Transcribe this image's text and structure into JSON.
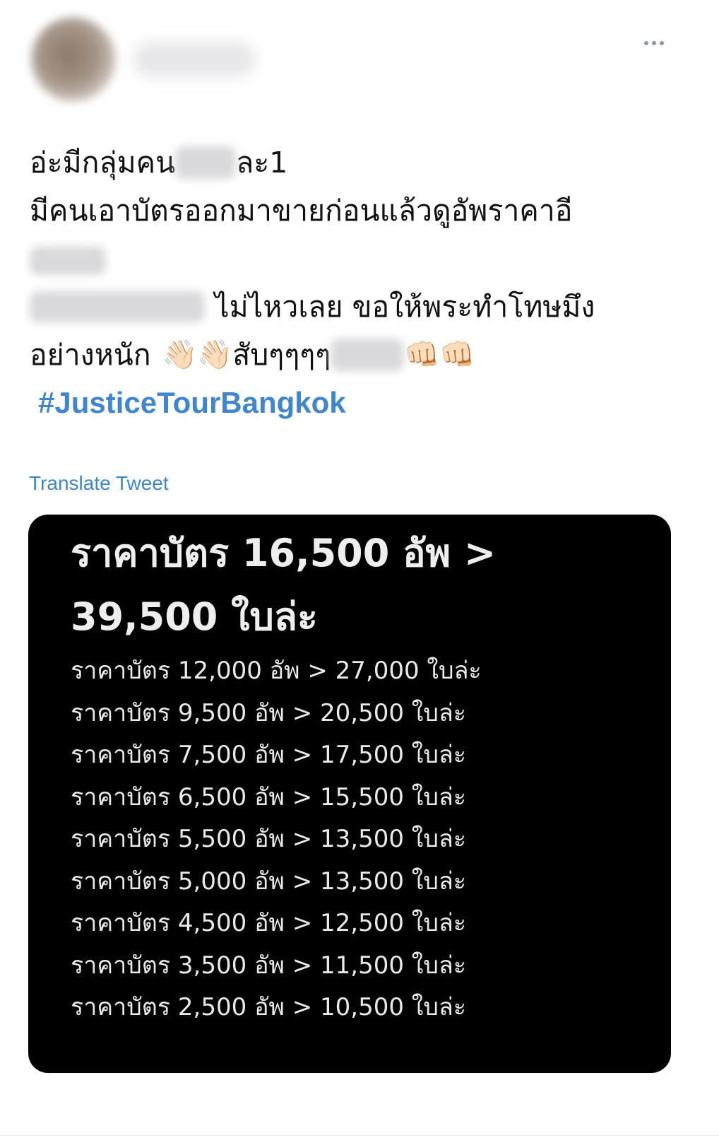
{
  "tweet": {
    "text_lines": [
      [
        "อ่ะมีกลุ่มคน",
        "",
        "ละ1"
      ],
      [
        "มีคนเอาบัตรออกมาขายก่อนแล้วดูอัพราคาอี"
      ],
      [
        "ไม่ไหวเลย ขอให้พระทำโทษมึง"
      ],
      [
        "อย่างหนัก",
        "👋🏻👋🏻",
        "สับๆๆๆๆ",
        "👊🏻👊🏻"
      ]
    ],
    "hashtag": "#JusticeTourBangkok",
    "translate_label": "Translate Tweet"
  },
  "media": {
    "headline": [
      "ราคาบัตร 16,500 อัพ >",
      "39,500 ใบล่ะ"
    ],
    "rows": [
      "ราคาบัตร 12,000 อัพ > 27,000 ใบล่ะ",
      "ราคาบัตร 9,500 อัพ > 20,500 ใบล่ะ",
      "ราคาบัตร 7,500 อัพ > 17,500 ใบล่ะ",
      "ราคาบัตร 6,500 อัพ > 15,500 ใบล่ะ",
      "ราคาบัตร 5,500 อัพ > 13,500 ใบล่ะ",
      "ราคาบัตร 5,000 อัพ > 13,500 ใบล่ะ",
      "ราคาบัตร 4,500 อัพ > 12,500 ใบล่ะ",
      "ราคาบัตร 3,500 อัพ > 11,500 ใบล่ะ",
      "ราคาบัตร 2,500 อัพ > 10,500 ใบล่ะ"
    ]
  },
  "icons": {
    "more": "more-horizontal-icon",
    "waving_hand": "waving-hand-icon",
    "fist": "oncoming-fist-icon"
  },
  "colors": {
    "link": "#3f86cf",
    "text": "#111111",
    "media_background": "#000000",
    "media_text": "#e9e9e9"
  }
}
